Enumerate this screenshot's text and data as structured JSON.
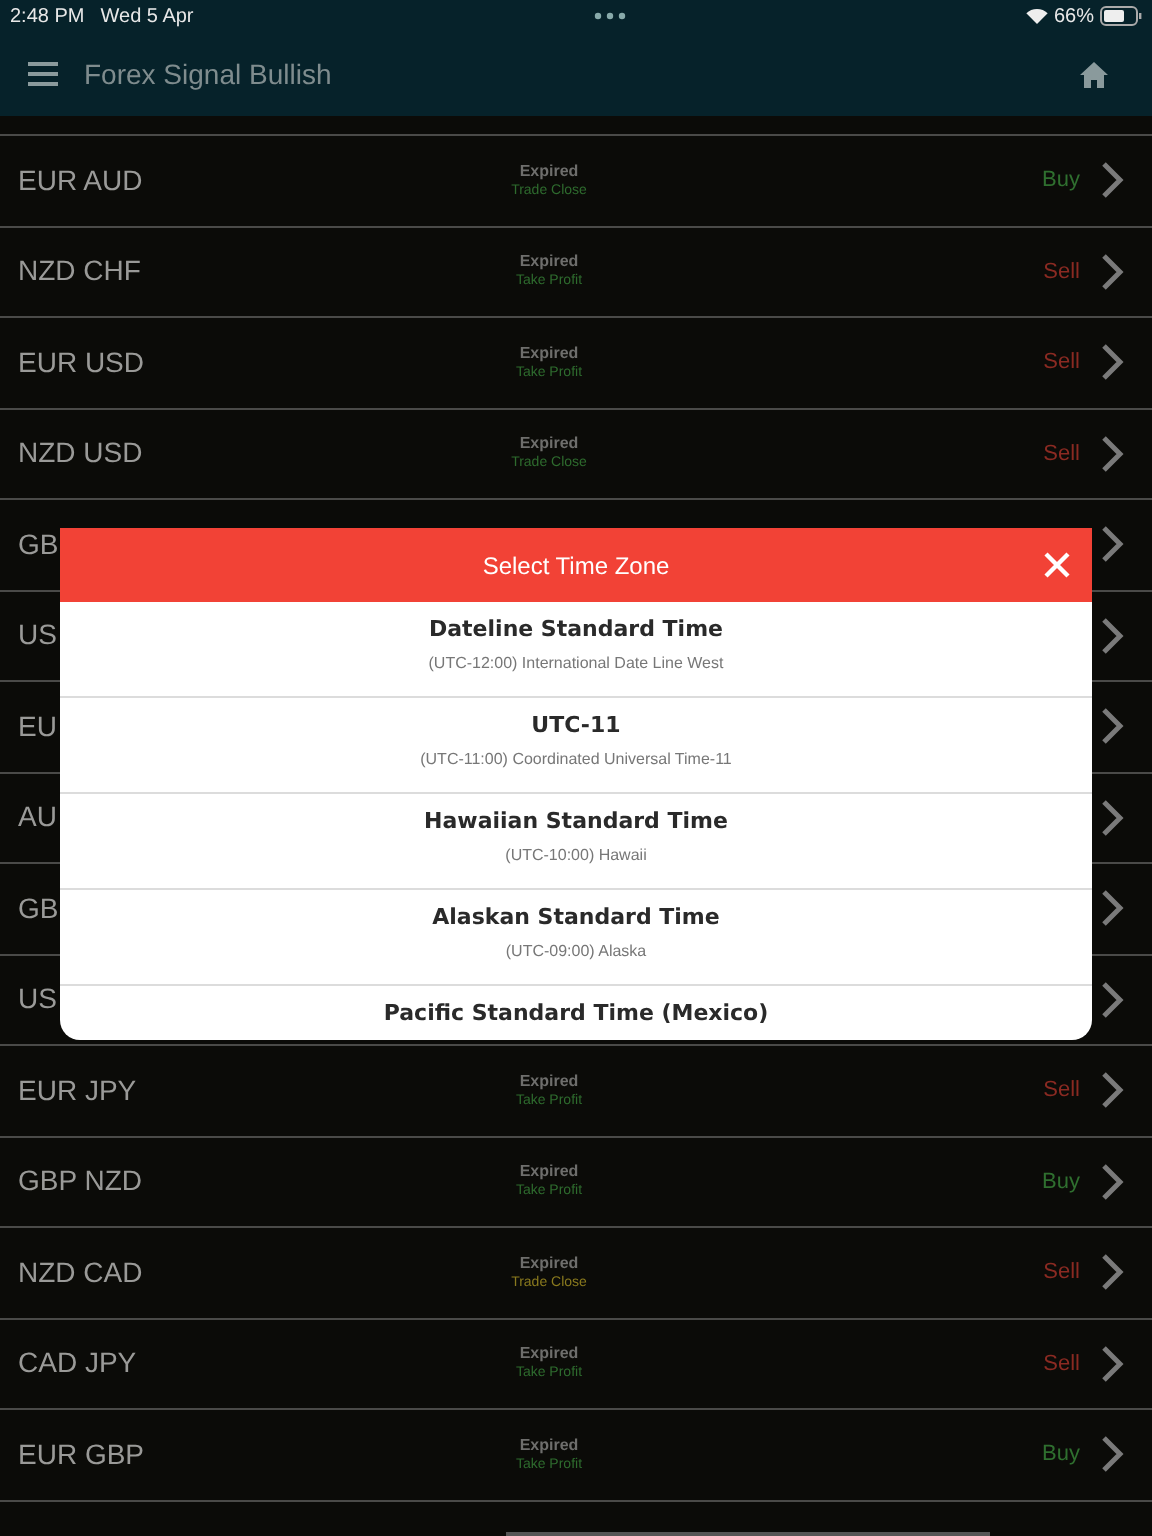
{
  "status_bar": {
    "time": "2:48 PM",
    "date": "Wed 5 Apr",
    "battery_text": "66%"
  },
  "nav": {
    "title": "Forex Signal Bullish"
  },
  "rows": [
    {
      "kind": "full",
      "pair": "EUR AUD",
      "status": "Expired",
      "result": "Trade Close",
      "color": "#2e6b2e",
      "side": {
        "text": "Buy",
        "color": "#2f6f2f"
      }
    },
    {
      "kind": "full",
      "pair": "NZD CHF",
      "status": "Expired",
      "result": "Take Profit",
      "color": "#2e6b2e",
      "side": {
        "text": "Sell",
        "color": "#8a2a22"
      }
    },
    {
      "kind": "full",
      "pair": "EUR USD",
      "status": "Expired",
      "result": "Take Profit",
      "color": "#2e6b2e",
      "side": {
        "text": "Sell",
        "color": "#8a2a22"
      }
    },
    {
      "kind": "full",
      "pair": "NZD USD",
      "status": "Expired",
      "result": "Trade Close",
      "color": "#2e6b2e",
      "side": {
        "text": "Sell",
        "color": "#8a2a22"
      }
    },
    {
      "kind": "covered",
      "pair": "GB"
    },
    {
      "kind": "covered",
      "pair": "US"
    },
    {
      "kind": "covered",
      "pair": "EU"
    },
    {
      "kind": "covered",
      "pair": "AU"
    },
    {
      "kind": "covered",
      "pair": "GB"
    },
    {
      "kind": "covered",
      "pair": "US"
    },
    {
      "kind": "full",
      "pair": "EUR JPY",
      "status": "Expired",
      "result": "Take Profit",
      "color": "#2e6b2e",
      "side": {
        "text": "Sell",
        "color": "#8a2a22"
      }
    },
    {
      "kind": "full",
      "pair": "GBP NZD",
      "status": "Expired",
      "result": "Take Profit",
      "color": "#2e6b2e",
      "side": {
        "text": "Buy",
        "color": "#2f6f2f"
      }
    },
    {
      "kind": "full",
      "pair": "NZD CAD",
      "status": "Expired",
      "result": "Trade Close",
      "color": "#8a7a1e",
      "side": {
        "text": "Sell",
        "color": "#8a2a22"
      }
    },
    {
      "kind": "full",
      "pair": "CAD JPY",
      "status": "Expired",
      "result": "Take Profit",
      "color": "#2e6b2e",
      "side": {
        "text": "Sell",
        "color": "#8a2a22"
      }
    },
    {
      "kind": "full",
      "pair": "EUR GBP",
      "status": "Expired",
      "result": "Take Profit",
      "color": "#2e6b2e",
      "side": {
        "text": "Buy",
        "color": "#2f6f2f"
      }
    }
  ],
  "dialog": {
    "title": "Select Time Zone",
    "items": [
      {
        "name": "Dateline Standard Time",
        "detail": "(UTC-12:00) International Date Line West"
      },
      {
        "name": "UTC-11",
        "detail": "(UTC-11:00) Coordinated Universal Time-11"
      },
      {
        "name": "Hawaiian Standard Time",
        "detail": "(UTC-10:00) Hawaii"
      },
      {
        "name": "Alaskan Standard Time",
        "detail": "(UTC-09:00) Alaska"
      },
      {
        "name": "Pacific Standard Time (Mexico)"
      }
    ]
  }
}
